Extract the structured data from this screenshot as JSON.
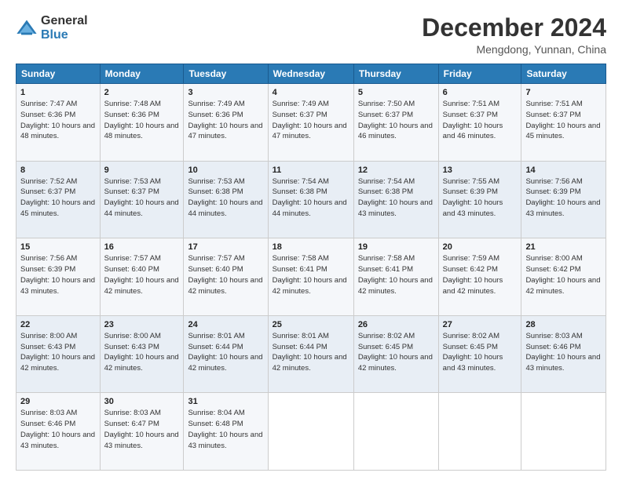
{
  "header": {
    "logo": {
      "general": "General",
      "blue": "Blue"
    },
    "title": "December 2024",
    "location": "Mengdong, Yunnan, China"
  },
  "days_of_week": [
    "Sunday",
    "Monday",
    "Tuesday",
    "Wednesday",
    "Thursday",
    "Friday",
    "Saturday"
  ],
  "weeks": [
    [
      {
        "day": "1",
        "sunrise": "7:47 AM",
        "sunset": "6:36 PM",
        "daylight": "10 hours and 48 minutes."
      },
      {
        "day": "2",
        "sunrise": "7:48 AM",
        "sunset": "6:36 PM",
        "daylight": "10 hours and 48 minutes."
      },
      {
        "day": "3",
        "sunrise": "7:49 AM",
        "sunset": "6:36 PM",
        "daylight": "10 hours and 47 minutes."
      },
      {
        "day": "4",
        "sunrise": "7:49 AM",
        "sunset": "6:37 PM",
        "daylight": "10 hours and 47 minutes."
      },
      {
        "day": "5",
        "sunrise": "7:50 AM",
        "sunset": "6:37 PM",
        "daylight": "10 hours and 46 minutes."
      },
      {
        "day": "6",
        "sunrise": "7:51 AM",
        "sunset": "6:37 PM",
        "daylight": "10 hours and 46 minutes."
      },
      {
        "day": "7",
        "sunrise": "7:51 AM",
        "sunset": "6:37 PM",
        "daylight": "10 hours and 45 minutes."
      }
    ],
    [
      {
        "day": "8",
        "sunrise": "7:52 AM",
        "sunset": "6:37 PM",
        "daylight": "10 hours and 45 minutes."
      },
      {
        "day": "9",
        "sunrise": "7:53 AM",
        "sunset": "6:37 PM",
        "daylight": "10 hours and 44 minutes."
      },
      {
        "day": "10",
        "sunrise": "7:53 AM",
        "sunset": "6:38 PM",
        "daylight": "10 hours and 44 minutes."
      },
      {
        "day": "11",
        "sunrise": "7:54 AM",
        "sunset": "6:38 PM",
        "daylight": "10 hours and 44 minutes."
      },
      {
        "day": "12",
        "sunrise": "7:54 AM",
        "sunset": "6:38 PM",
        "daylight": "10 hours and 43 minutes."
      },
      {
        "day": "13",
        "sunrise": "7:55 AM",
        "sunset": "6:39 PM",
        "daylight": "10 hours and 43 minutes."
      },
      {
        "day": "14",
        "sunrise": "7:56 AM",
        "sunset": "6:39 PM",
        "daylight": "10 hours and 43 minutes."
      }
    ],
    [
      {
        "day": "15",
        "sunrise": "7:56 AM",
        "sunset": "6:39 PM",
        "daylight": "10 hours and 43 minutes."
      },
      {
        "day": "16",
        "sunrise": "7:57 AM",
        "sunset": "6:40 PM",
        "daylight": "10 hours and 42 minutes."
      },
      {
        "day": "17",
        "sunrise": "7:57 AM",
        "sunset": "6:40 PM",
        "daylight": "10 hours and 42 minutes."
      },
      {
        "day": "18",
        "sunrise": "7:58 AM",
        "sunset": "6:41 PM",
        "daylight": "10 hours and 42 minutes."
      },
      {
        "day": "19",
        "sunrise": "7:58 AM",
        "sunset": "6:41 PM",
        "daylight": "10 hours and 42 minutes."
      },
      {
        "day": "20",
        "sunrise": "7:59 AM",
        "sunset": "6:42 PM",
        "daylight": "10 hours and 42 minutes."
      },
      {
        "day": "21",
        "sunrise": "8:00 AM",
        "sunset": "6:42 PM",
        "daylight": "10 hours and 42 minutes."
      }
    ],
    [
      {
        "day": "22",
        "sunrise": "8:00 AM",
        "sunset": "6:43 PM",
        "daylight": "10 hours and 42 minutes."
      },
      {
        "day": "23",
        "sunrise": "8:00 AM",
        "sunset": "6:43 PM",
        "daylight": "10 hours and 42 minutes."
      },
      {
        "day": "24",
        "sunrise": "8:01 AM",
        "sunset": "6:44 PM",
        "daylight": "10 hours and 42 minutes."
      },
      {
        "day": "25",
        "sunrise": "8:01 AM",
        "sunset": "6:44 PM",
        "daylight": "10 hours and 42 minutes."
      },
      {
        "day": "26",
        "sunrise": "8:02 AM",
        "sunset": "6:45 PM",
        "daylight": "10 hours and 42 minutes."
      },
      {
        "day": "27",
        "sunrise": "8:02 AM",
        "sunset": "6:45 PM",
        "daylight": "10 hours and 43 minutes."
      },
      {
        "day": "28",
        "sunrise": "8:03 AM",
        "sunset": "6:46 PM",
        "daylight": "10 hours and 43 minutes."
      }
    ],
    [
      {
        "day": "29",
        "sunrise": "8:03 AM",
        "sunset": "6:46 PM",
        "daylight": "10 hours and 43 minutes."
      },
      {
        "day": "30",
        "sunrise": "8:03 AM",
        "sunset": "6:47 PM",
        "daylight": "10 hours and 43 minutes."
      },
      {
        "day": "31",
        "sunrise": "8:04 AM",
        "sunset": "6:48 PM",
        "daylight": "10 hours and 43 minutes."
      },
      null,
      null,
      null,
      null
    ]
  ]
}
